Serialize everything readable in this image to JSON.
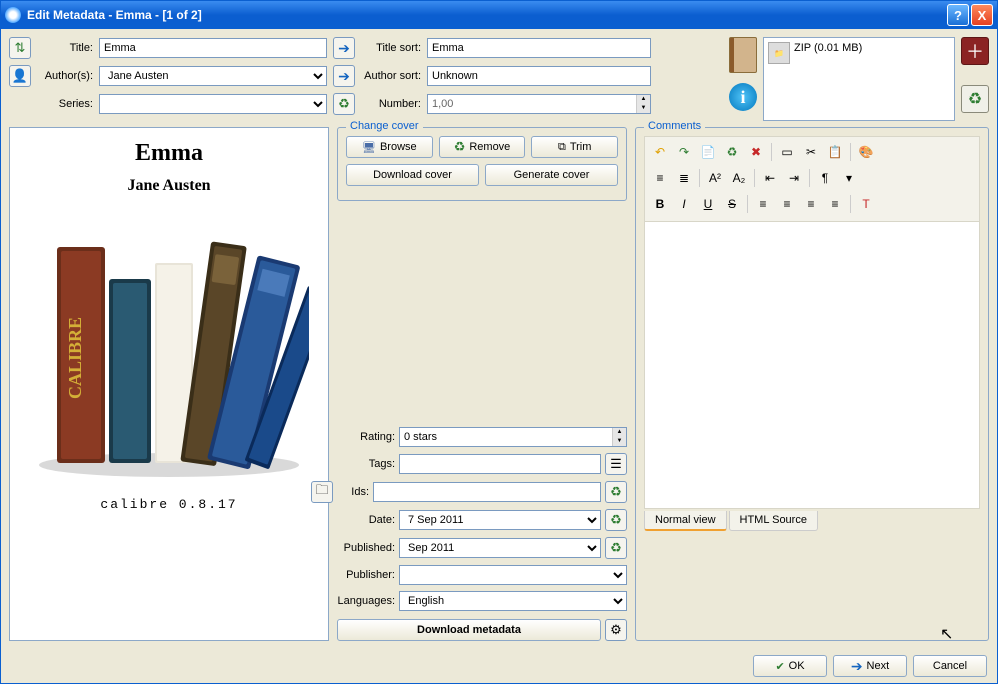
{
  "titlebar": "Edit Metadata - Emma -  [1 of 2]",
  "labels": {
    "title": "Title:",
    "title_sort": "Title sort:",
    "authors": "Author(s):",
    "author_sort": "Author sort:",
    "series": "Series:",
    "number": "Number:"
  },
  "values": {
    "title": "Emma",
    "title_sort": "Emma",
    "author": "Jane Austen",
    "author_sort": "Unknown",
    "series": "",
    "number": "1,00"
  },
  "format_box": {
    "label": "ZIP (0.01 MB)"
  },
  "cover": {
    "title": "Emma",
    "author": "Jane Austen",
    "calibre_version": "calibre 0.8.17"
  },
  "change_cover": {
    "legend": "Change cover",
    "browse": "Browse",
    "remove": "Remove",
    "trim": "Trim",
    "download": "Download cover",
    "generate": "Generate cover"
  },
  "meta": {
    "rating_label": "Rating:",
    "rating_value": "0 stars",
    "tags_label": "Tags:",
    "tags_value": "",
    "ids_label": "Ids:",
    "ids_value": "",
    "date_label": "Date:",
    "date_value": "7 Sep 2011",
    "published_label": "Published:",
    "published_value": "Sep 2011",
    "publisher_label": "Publisher:",
    "publisher_value": "",
    "languages_label": "Languages:",
    "languages_value": "English"
  },
  "download_metadata": "Download metadata",
  "comments": {
    "legend": "Comments",
    "tab_normal": "Normal view",
    "tab_html": "HTML Source"
  },
  "buttons": {
    "ok": "OK",
    "next": "Next",
    "cancel": "Cancel"
  }
}
